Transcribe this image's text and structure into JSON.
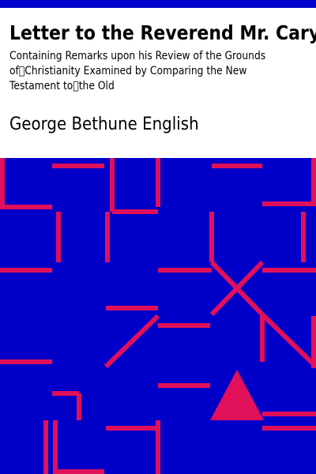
{
  "book": {
    "title": "Letter to the Reverend Mr. Cary",
    "subtitle": "Containing Remarks upon his Review of the Grounds of\u0000Christianity Examined by Comparing the New Testament to\u0000the Old",
    "author": "George Bethune English"
  },
  "colors": {
    "top_bar": "#0000c8",
    "background": "#ffffff",
    "art_background": "#0000c8",
    "art_stroke": "#e0105a",
    "text": "#000000"
  }
}
